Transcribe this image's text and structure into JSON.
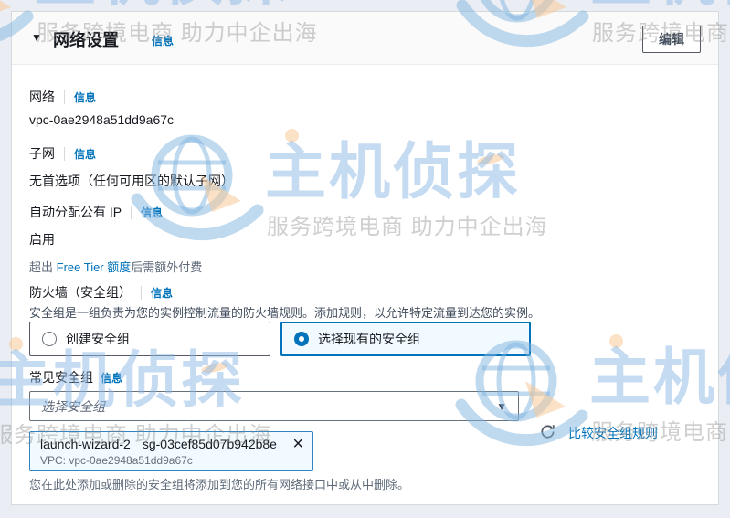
{
  "watermark": {
    "brand": "主机侦探",
    "tagline": "服务跨境电商 助力中企出海"
  },
  "panel": {
    "header": {
      "collapse_icon": "▼",
      "title": "网络设置",
      "info": "信息",
      "edit_button": "编辑"
    },
    "network": {
      "label": "网络",
      "info": "信息",
      "value": "vpc-0ae2948a51dd9a67c"
    },
    "subnet": {
      "label": "子网",
      "info": "信息",
      "value": "无首选项（任何可用区的默认子网）"
    },
    "auto_public_ip": {
      "label": "自动分配公有 IP",
      "info": "信息",
      "value": "启用",
      "note_prefix": "超出 ",
      "note_link": "Free Tier 额度",
      "note_suffix": "后需额外付费"
    },
    "firewall": {
      "label": "防火墙（安全组）",
      "info": "信息",
      "description": "安全组是一组负责为您的实例控制流量的防火墙规则。添加规则，以允许特定流量到达您的实例。",
      "options": [
        {
          "label": "创建安全组",
          "selected": false
        },
        {
          "label": "选择现有的安全组",
          "selected": true
        }
      ]
    },
    "common_sg": {
      "label": "常见安全组",
      "info": "信息",
      "select_placeholder": "选择安全组",
      "select_caret": "▼",
      "compare_link": "比较安全组规则",
      "chip": {
        "name": "launch-wizard-2",
        "sg_id": "sg-03cef85d07b942b8e",
        "remove_icon": "×",
        "vpc_line": "VPC: vpc-0ae2948a51dd9a67c"
      },
      "footer_note": "您在此处添加或删除的安全组将添加到您的所有网络接口中或从中删除。"
    }
  },
  "colors": {
    "link_blue": "#0073bb",
    "selected_bg": "#f1faff",
    "selected_border": "#0073bb",
    "watermark_blue": "#8bb8e5",
    "watermark_orange": "#f8c896"
  }
}
